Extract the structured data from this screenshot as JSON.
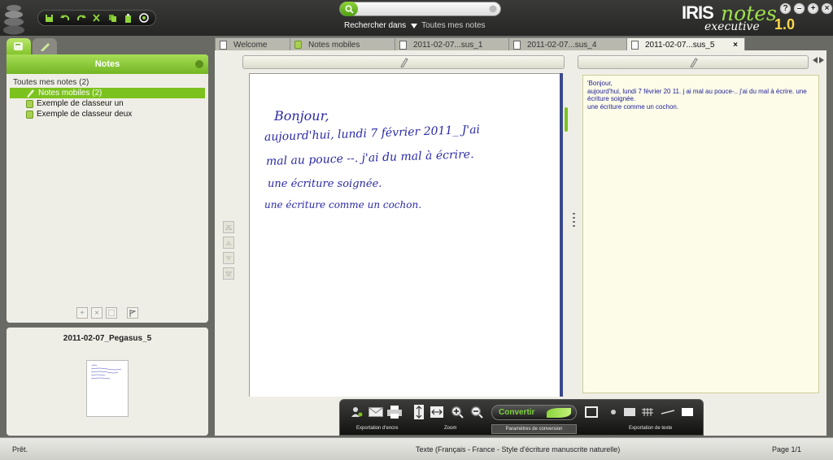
{
  "app": {
    "brand_iris": "IRIS",
    "brand_notes": "notes",
    "brand_edition": "executive",
    "brand_version": "1.0"
  },
  "window_controls": {
    "help": "?",
    "minimize": "–",
    "maximize": "+",
    "close": "×"
  },
  "search": {
    "placeholder": "",
    "scope_label": "Rechercher dans",
    "scope_value": "Toutes mes notes"
  },
  "left_panel": {
    "header": "Notes",
    "tree_root": "Toutes mes notes (2)",
    "items": [
      {
        "label": "Notes mobiles (2)",
        "selected": true
      },
      {
        "label": "Exemple de classeur un",
        "selected": false
      },
      {
        "label": "Exemple de classeur deux",
        "selected": false
      }
    ],
    "preview_title": "2011-02-07_Pegasus_5"
  },
  "tabs": [
    {
      "label": "Welcome"
    },
    {
      "label": "Notes mobiles"
    },
    {
      "label": "2011-02-07...sus_1"
    },
    {
      "label": "2011-02-07...sus_4"
    },
    {
      "label": "2011-02-07...sus_5",
      "active": true,
      "close": "×"
    }
  ],
  "handwriting": {
    "lines": [
      "Bonjour,",
      "aujourd'hui, lundi 7 février 2011_ J'ai",
      "mal au pouce --. j'ai du mal à écrire.",
      "une écriture soignée.",
      "une écriture comme un cochon."
    ]
  },
  "recognized_text": {
    "lines": [
      "'Bonjour,",
      "aujourd'hui, lundi 7 février 20 11. j ai mal au pouce-.. j'ai du mal à écrire. une écriture soignée.",
      "une écriture comme un cochon."
    ]
  },
  "dock": {
    "export_ink_label": "Exportation d'encre",
    "zoom_label": "Zoom",
    "convert_label": "Convertir",
    "conversion_params_label": "Paramètres de conversion",
    "export_text_label": "Exportation de texte"
  },
  "status": {
    "left": "Prêt.",
    "center": "Texte (Français - France - Style d'écriture manuscrite naturelle)",
    "right": "Page 1/1"
  },
  "colors": {
    "accent_green": "#7cc21f",
    "ink_blue": "#2a2aa5",
    "text_blue": "#1d1d9a"
  }
}
